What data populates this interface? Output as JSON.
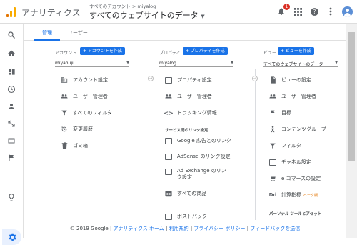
{
  "header": {
    "app_name": "アナリティクス",
    "breadcrumb": "すべてのアカウント > miyalog",
    "view_title": "すべてのウェブサイトのデータ",
    "notification_count": "1"
  },
  "tabs": {
    "admin": "管理",
    "user": "ユーザー"
  },
  "account": {
    "label": "アカウント",
    "create_button": "+ アカウントを作成",
    "selected": "miyahuji",
    "items": [
      "アカウント設定",
      "ユーザー管理者",
      "すべてのフィルタ",
      "変更履歴",
      "ゴミ箱"
    ]
  },
  "property": {
    "label": "プロパティ",
    "create_button": "+ プロパティを作成",
    "selected": "miyalog",
    "items": [
      "プロパティ設定",
      "ユーザー管理者",
      "トラッキング情報"
    ],
    "link_section": "サービス間のリンク設定",
    "links": [
      "Google 広告とのリンク",
      "AdSense のリンク設定",
      "Ad Exchange のリンク設定",
      "すべての商品",
      "ポストバック"
    ]
  },
  "view": {
    "label": "ビュー",
    "create_button": "+ ビューを作成",
    "selected": "すべてのウェブサイトのデータ",
    "items": [
      "ビューの設定",
      "ユーザー管理者",
      "目標",
      "コンテンツグループ",
      "フィルタ",
      "チャネル設定",
      "e コマースの設定",
      "計算指標"
    ],
    "beta": "ベータ版",
    "personal_section": "パーソナル ツールとアセット"
  },
  "footer": {
    "copyright": "© 2019 Google",
    "links": [
      "アナリティクス ホーム",
      "利用規約",
      "プライバシー ポリシー",
      "フィードバックを送信"
    ],
    "separator": " | "
  },
  "colors": {
    "accent": "#1a73e8",
    "annotation_arrow": "#e21b1b"
  }
}
